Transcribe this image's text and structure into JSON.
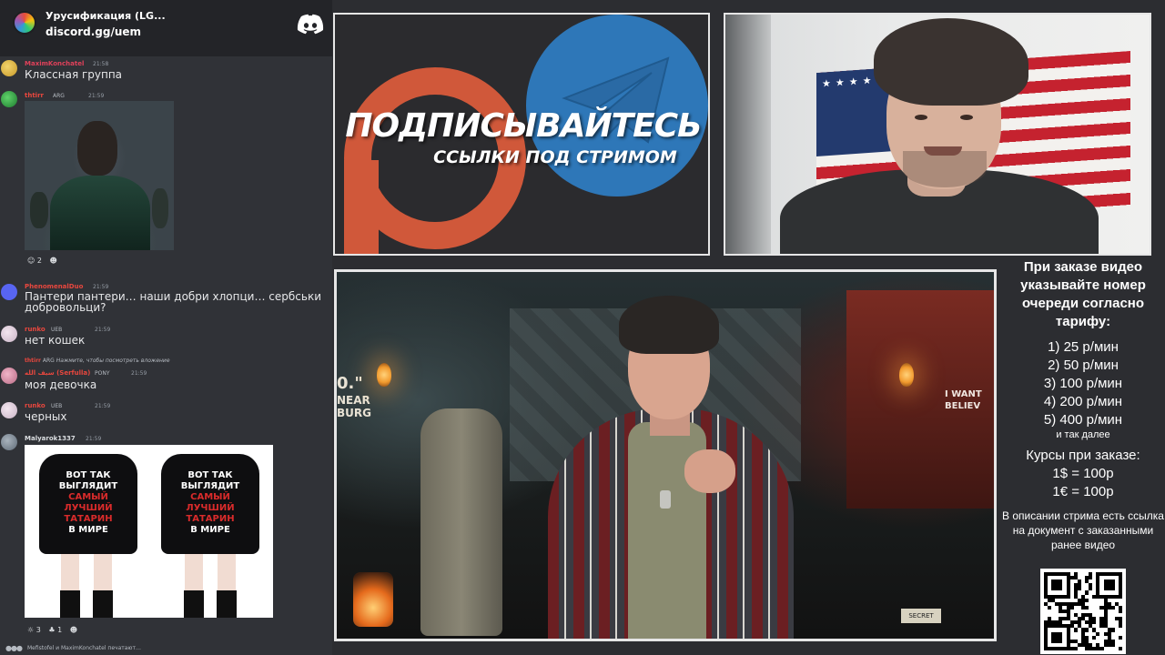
{
  "server": {
    "name": "Урусификация (LG...",
    "invite": "discord.gg/uem",
    "logo_icon": "discord-logo-icon"
  },
  "messages": [
    {
      "author": "MaximKonchatel",
      "author_color": "#e0415a",
      "time": "21:58",
      "text": "Классная группа"
    },
    {
      "author": "thtirr",
      "author_color": "#e8473e",
      "badges": "ARG",
      "time": "21:59",
      "text": "",
      "attachment": "image",
      "reactions": [
        {
          "emoji": "face-emoji",
          "count": "2"
        },
        {
          "emoji": "add-reaction",
          "count": ""
        }
      ]
    },
    {
      "author": "PhenomenalDuo",
      "author_color": "#e8473e",
      "time": "21:59",
      "text": "Пантери пантери… наши добри хлопци… сербськи добровольци?"
    },
    {
      "author": "runko",
      "author_color": "#e8473e",
      "badges": "UEB",
      "time": "21:59",
      "text": "нет кошек"
    },
    {
      "reply_author": "thtirr",
      "reply_badges": "ARG",
      "reply_text": "Нажмите, чтобы посмотреть вложение",
      "author": "سيف الله (Serfulla)",
      "author_color": "#e8473e",
      "badges": "PONY",
      "time": "21:59",
      "text": "моя девочка"
    },
    {
      "author": "runko",
      "author_color": "#e8473e",
      "badges": "UEB",
      "time": "21:59",
      "text": "черных"
    },
    {
      "author": "Malyarok1337",
      "author_color": "#dbdee1",
      "time": "21:59",
      "text": "",
      "attachment": "image",
      "reactions": [
        {
          "emoji": "emoji-1",
          "count": "3"
        },
        {
          "emoji": "emoji-2",
          "count": "1"
        },
        {
          "emoji": "add-reaction",
          "count": ""
        }
      ]
    }
  ],
  "shirt_print": {
    "line1": "ВОТ ТАК",
    "line2": "ВЫГЛЯДИТ",
    "line3": "САМЫЙ",
    "line4": "ЛУЧШИЙ",
    "line5": "ТАТАРИН",
    "line6": "В МИРЕ"
  },
  "typing": "Mefistofel и MaximKonchatel печатают…",
  "banner": {
    "title": "ПОДПИСЫВАЙТЕСЬ",
    "subtitle": "ССЫЛКИ ПОД СТРИМОМ",
    "patreon_color": "#d0583a",
    "telegram_color": "#2e77b8"
  },
  "video": {
    "sign_left_1": "0.\"",
    "sign_left_2": "NEAR",
    "sign_left_3": "BURG",
    "sign_right_1": "I WANT",
    "sign_right_2": "BELIEV",
    "sticker": "SECRET"
  },
  "info": {
    "heading": "При заказе видео указывайте номер очереди согласно тарифу:",
    "tariffs": [
      "1) 25 р/мин",
      "2) 50 р/мин",
      "3) 100 р/мин",
      "4) 200 р/мин",
      "5) 400 р/мин"
    ],
    "etc": "и так далее",
    "rates_heading": "Курсы при заказе:",
    "rates": [
      "1$ = 100р",
      "1€ = 100р"
    ],
    "description": "В описании стрима есть ссылка на документ с заказанными ранее видео"
  }
}
